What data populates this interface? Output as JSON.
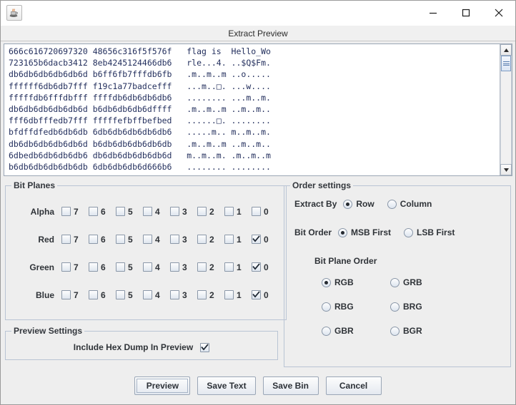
{
  "window": {
    "app_icon": "java-coffee-cup-icon",
    "caption": "Extract Preview",
    "controls": {
      "minimize": "minimize-icon",
      "maximize": "maximize-icon",
      "close": "close-icon"
    }
  },
  "preview": {
    "lines": [
      "666c616720697320 48656c316f5f576f   flag is  Hello_Wo",
      "723165b6dacb3412 8eb4245124466db6   rle...4. ..$Q$Fm.",
      "db6db6db6db6db6d b6ff6fb7fffdb6fb   .m..m..m ..o.....",
      "ffffff6db6db7fff f19c1a77badcefff   ...m..□. ...w....",
      "fffffdb6fffdbfff ffffdb6db6db6db6   ........ ...m..m.",
      "db6db6db6db6db6d b6db6db6db6dffff   .m..m..m ..m..m..",
      "fff6dbfffedb7fff fffffefbffbefbed   ......□. ........",
      "bfdffdfedb6db6db 6db6db6db6db6db6   .....m.. m..m..m.",
      "db6db6db6db6db6d b6db6db6db6db6db   .m..m..m ..m..m..",
      "6dbedb6db6db6db6 db6db6db6db6db6d   m..m..m. .m..m..m",
      "b6db6db6db6db6db 6db6db6db6d666b6   ........ ........"
    ],
    "scrollbar": {
      "up_arrow": "scroll-up-icon",
      "down_arrow": "scroll-down-icon"
    }
  },
  "bit_planes": {
    "legend": "Bit Planes",
    "bit_labels": [
      "7",
      "6",
      "5",
      "4",
      "3",
      "2",
      "1",
      "0"
    ],
    "rows": [
      {
        "label": "Alpha",
        "checked": [
          false,
          false,
          false,
          false,
          false,
          false,
          false,
          false
        ]
      },
      {
        "label": "Red",
        "checked": [
          false,
          false,
          false,
          false,
          false,
          false,
          false,
          true
        ]
      },
      {
        "label": "Green",
        "checked": [
          false,
          false,
          false,
          false,
          false,
          false,
          false,
          true
        ]
      },
      {
        "label": "Blue",
        "checked": [
          false,
          false,
          false,
          false,
          false,
          false,
          false,
          true
        ]
      }
    ]
  },
  "preview_settings": {
    "legend": "Preview Settings",
    "include_hex_dump_label": "Include Hex Dump In Preview",
    "include_hex_dump_checked": true
  },
  "order_settings": {
    "legend": "Order settings",
    "extract_by": {
      "caption": "Extract By",
      "options": [
        "Row",
        "Column"
      ],
      "selected": "Row"
    },
    "bit_order": {
      "caption": "Bit Order",
      "options": [
        "MSB First",
        "LSB First"
      ],
      "selected": "MSB First"
    },
    "bit_plane_order": {
      "caption": "Bit Plane Order",
      "options": [
        "RGB",
        "GRB",
        "RBG",
        "BRG",
        "GBR",
        "BGR"
      ],
      "selected": "RGB"
    }
  },
  "buttons": {
    "preview": "Preview",
    "save_text": "Save Text",
    "save_bin": "Save Bin",
    "cancel": "Cancel"
  },
  "colors": {
    "panel_bg": "#eeeeee",
    "text_blue": "#24305e",
    "group_border": "#b9c4d4",
    "selected_radio": "#24292f"
  }
}
